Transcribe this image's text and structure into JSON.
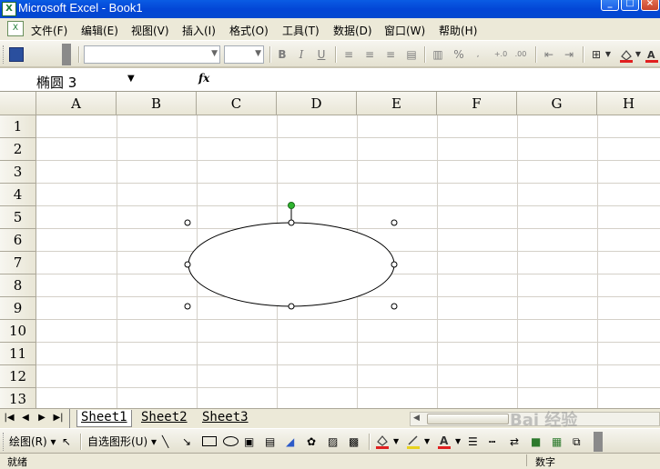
{
  "window": {
    "title": "Microsoft Excel - Book1",
    "app_icon": "excel-icon",
    "controls": [
      "minimize-icon",
      "maximize-icon",
      "close-icon"
    ]
  },
  "menubar": {
    "items": [
      {
        "label": "文件(F)"
      },
      {
        "label": "编辑(E)"
      },
      {
        "label": "视图(V)"
      },
      {
        "label": "插入(I)"
      },
      {
        "label": "格式(O)"
      },
      {
        "label": "工具(T)"
      },
      {
        "label": "数据(D)"
      },
      {
        "label": "窗口(W)"
      },
      {
        "label": "帮助(H)"
      }
    ]
  },
  "toolbar": {
    "buttons": [
      "save-icon",
      "bold-icon",
      "italic-icon",
      "underline-icon",
      "align-left-icon",
      "align-center-icon",
      "align-right-icon",
      "merge-icon",
      "currency-icon",
      "percent-icon",
      "increase-decimal-icon",
      "decrease-decimal-icon",
      "decrease-indent-icon",
      "increase-indent-icon",
      "borders-icon",
      "fill-color-icon",
      "font-color-icon"
    ],
    "bold": "B",
    "italic": "I",
    "underline": "U",
    "percent": "%"
  },
  "formulabar": {
    "name_box": "椭圆 3",
    "fx": "fx",
    "formula": ""
  },
  "grid": {
    "columns": [
      "A",
      "B",
      "C",
      "D",
      "E",
      "F",
      "G",
      "H"
    ],
    "rows": [
      "1",
      "2",
      "3",
      "4",
      "5",
      "6",
      "7",
      "8",
      "9",
      "10",
      "11",
      "12",
      "13"
    ],
    "shape": {
      "type": "ellipse",
      "name": "椭圆 3",
      "selected": true,
      "rotation_handle_color": "#2fb52f"
    }
  },
  "sheets": {
    "tabs": [
      "Sheet1",
      "Sheet2",
      "Sheet3"
    ],
    "active": "Sheet1"
  },
  "drawbar": {
    "draw_label": "绘图(R)",
    "autoshapes_label": "自选图形(U)"
  },
  "statusbar": {
    "left": "就绪",
    "right": "数字"
  },
  "watermark": {
    "text": "Bai 经验"
  },
  "colors": {
    "titlebar": "#0a5ce4",
    "fill_accent": "#e02020",
    "line_accent": "#e8d21e"
  }
}
